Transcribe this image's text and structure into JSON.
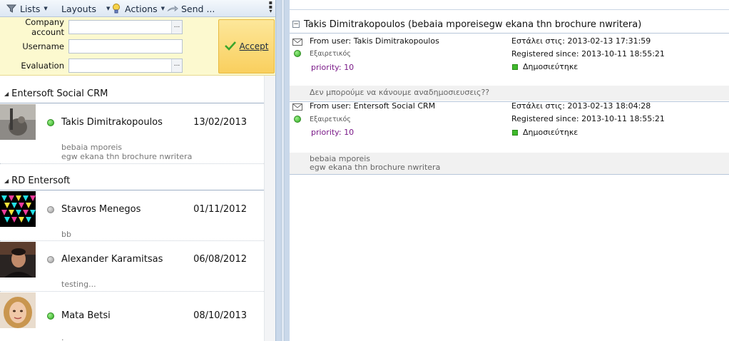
{
  "toolbar": {
    "lists": "Lists",
    "layouts": "Layouts",
    "actions": "Actions",
    "send": "Send ..."
  },
  "filter": {
    "company_account_label": "Company account",
    "username_label": "Username",
    "evaluation_label": "Evaluation",
    "company_account_value": "",
    "username_value": "",
    "evaluation_value": "",
    "ellipsis": "...",
    "accept_label": "Accept"
  },
  "groups": [
    {
      "title": "Entersoft Social CRM",
      "items": [
        {
          "name": "Takis Dimitrakopoulos",
          "date": "13/02/2013",
          "status": "green",
          "snippet": "bebaia mporeis\negw ekana thn brochure nwritera"
        }
      ]
    },
    {
      "title": "RD Entersoft",
      "items": [
        {
          "name": "Stavros Menegos",
          "date": "01/11/2012",
          "status": "gray",
          "snippet": "bb"
        },
        {
          "name": "Alexander Karamitsas",
          "date": "06/08/2012",
          "status": "gray",
          "snippet": "testing..."
        },
        {
          "name": "Mata Betsi",
          "date": "08/10/2013",
          "status": "green",
          "snippet": "."
        }
      ]
    }
  ],
  "conversation": {
    "title": "Takis Dimitrakopoulos (bebaia mporeisegw ekana thn brochure nwritera)",
    "messages": [
      {
        "from": "From user: Takis Dimitrakopoulos",
        "sent": "Εστάλει στις: 2013-02-13 17:31:59",
        "sentiment": "Εξαιρετικός",
        "registered": "Registered since: 2013-10-11 18:55:21",
        "priority": "priority: 10",
        "published": "Δημοσιεύτηκε",
        "body": "Δεν μπορούμε να κάνουμε αναδημοσιευσεις??"
      },
      {
        "from": "From user: Entersoft Social CRM",
        "sent": "Εστάλει στις: 2013-02-13 18:04:28",
        "sentiment": "Εξαιρετικός",
        "registered": "Registered since: 2013-10-11 18:55:21",
        "priority": "priority: 10",
        "published": "Δημοσιεύτηκε",
        "body": "bebaia mporeis\negw ekana thn brochure nwritera"
      }
    ]
  },
  "colors": {
    "filter_bg": "#fcf9cf",
    "accept_bg": "#f9cf5e",
    "status_green": "#2ea91f",
    "status_gray": "#9a9a9a",
    "priority": "#7a1a88",
    "toolbar_bg": "#dde7f3"
  },
  "icons": {
    "lists": "funnel-icon",
    "actions": "lightbulb-icon",
    "send": "send-icon",
    "accept": "checkmark-icon",
    "message": "envelope-icon",
    "collapse": "minus-icon"
  }
}
